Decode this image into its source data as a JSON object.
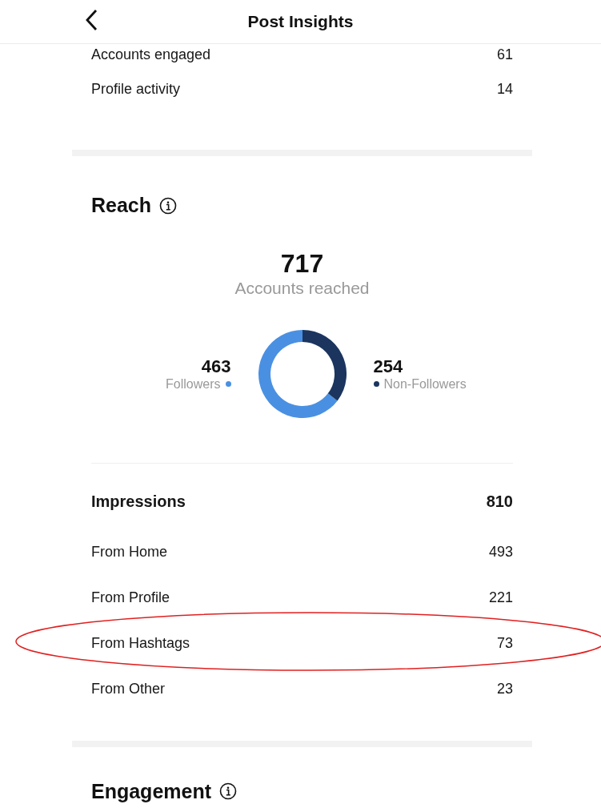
{
  "header": {
    "title": "Post Insights"
  },
  "summary_rows": [
    {
      "label": "Accounts engaged",
      "value": "61"
    },
    {
      "label": "Profile activity",
      "value": "14"
    }
  ],
  "reach": {
    "title": "Reach",
    "total": "717",
    "chart_data": {
      "type": "donut",
      "categories": [
        "Followers",
        "Non-Followers"
      ],
      "series": [
        {
          "name": "Accounts reached",
          "values": [
            64.6,
            35.4
          ]
        }
      ]
    },
    "segments": [
      {
        "value": "463",
        "color": "#4a90e2"
      },
      {
        "value": "254",
        "color": "#1b355f"
      }
    ]
  },
  "impressions": {
    "title": "Impressions",
    "total": "810",
    "rows": [
      {
        "label": "From Home",
        "value": "493",
        "highlighted": false
      },
      {
        "label": "From Profile",
        "value": "221",
        "highlighted": false
      },
      {
        "label": "From Hashtags",
        "value": "73",
        "highlighted": true
      },
      {
        "label": "From Other",
        "value": "23",
        "highlighted": false
      }
    ]
  },
  "engagement": {
    "title": "Engagement"
  }
}
